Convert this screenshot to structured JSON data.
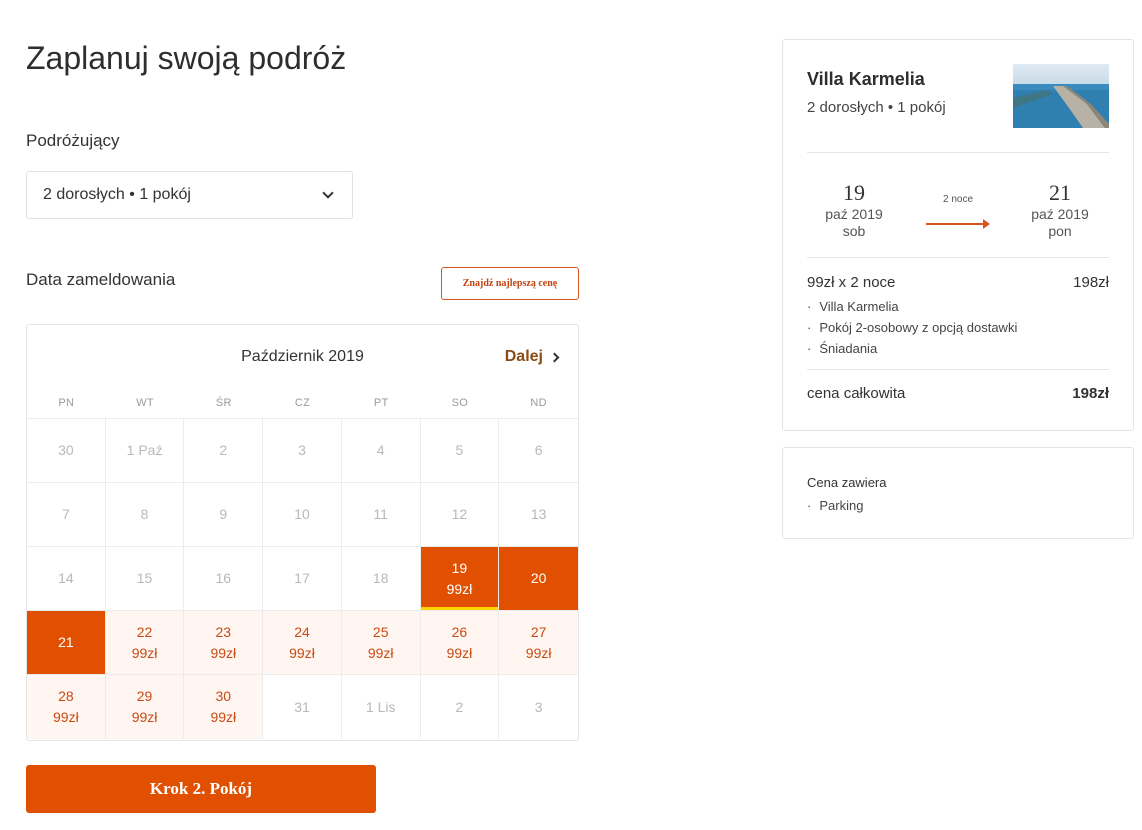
{
  "page_title": "Zaplanuj swoją podróż",
  "travelers": {
    "label": "Podróżujący",
    "value": "2 dorosłych • 1 pokój"
  },
  "checkin": {
    "label": "Data zameldowania",
    "best_price_button": "Znajdź najlepszą cenę"
  },
  "calendar": {
    "month": "Październik 2019",
    "next_label": "Dalej",
    "weekdays": [
      "PN",
      "WT",
      "ŚR",
      "CZ",
      "PT",
      "SO",
      "ND"
    ],
    "days": [
      {
        "day": "30",
        "price": "",
        "state": "past"
      },
      {
        "day": "1 Paź",
        "price": "",
        "state": "past"
      },
      {
        "day": "2",
        "price": "",
        "state": "past"
      },
      {
        "day": "3",
        "price": "",
        "state": "past"
      },
      {
        "day": "4",
        "price": "",
        "state": "past"
      },
      {
        "day": "5",
        "price": "",
        "state": "past"
      },
      {
        "day": "6",
        "price": "",
        "state": "past"
      },
      {
        "day": "7",
        "price": "",
        "state": "past"
      },
      {
        "day": "8",
        "price": "",
        "state": "past"
      },
      {
        "day": "9",
        "price": "",
        "state": "past"
      },
      {
        "day": "10",
        "price": "",
        "state": "past"
      },
      {
        "day": "11",
        "price": "",
        "state": "past"
      },
      {
        "day": "12",
        "price": "",
        "state": "past"
      },
      {
        "day": "13",
        "price": "",
        "state": "past"
      },
      {
        "day": "14",
        "price": "",
        "state": "past"
      },
      {
        "day": "15",
        "price": "",
        "state": "past"
      },
      {
        "day": "16",
        "price": "",
        "state": "past"
      },
      {
        "day": "17",
        "price": "",
        "state": "past"
      },
      {
        "day": "18",
        "price": "",
        "state": "past"
      },
      {
        "day": "19",
        "price": "99zł",
        "state": "selected-start"
      },
      {
        "day": "20",
        "price": "",
        "state": "selected"
      },
      {
        "day": "21",
        "price": "",
        "state": "selected"
      },
      {
        "day": "22",
        "price": "99zł",
        "state": "available"
      },
      {
        "day": "23",
        "price": "99zł",
        "state": "available"
      },
      {
        "day": "24",
        "price": "99zł",
        "state": "available"
      },
      {
        "day": "25",
        "price": "99zł",
        "state": "available"
      },
      {
        "day": "26",
        "price": "99zł",
        "state": "available"
      },
      {
        "day": "27",
        "price": "99zł",
        "state": "available"
      },
      {
        "day": "28",
        "price": "99zł",
        "state": "available"
      },
      {
        "day": "29",
        "price": "99zł",
        "state": "available"
      },
      {
        "day": "30",
        "price": "99zł",
        "state": "available"
      },
      {
        "day": "31",
        "price": "",
        "state": "unavailable"
      },
      {
        "day": "1 Lis",
        "price": "",
        "state": "unavailable"
      },
      {
        "day": "2",
        "price": "",
        "state": "unavailable"
      },
      {
        "day": "3",
        "price": "",
        "state": "unavailable"
      }
    ]
  },
  "step_button": "Krok 2. Pokój",
  "summary": {
    "hotel_name": "Villa Karmelia",
    "guests": "2 dorosłych • 1 pokój",
    "checkin": {
      "day": "19",
      "month": "paź 2019",
      "weekday": "sob"
    },
    "checkout": {
      "day": "21",
      "month": "paź 2019",
      "weekday": "pon"
    },
    "nights": "2 noce",
    "price_line": "99zł x 2 noce",
    "price_amount": "198zł",
    "items": [
      "Villa Karmelia",
      "Pokój 2-osobowy z opcją dostawki",
      "Śniadania"
    ],
    "total_label": "cena całkowita",
    "total_amount": "198zł"
  },
  "includes": {
    "title": "Cena zawiera",
    "items": [
      "Parking"
    ]
  },
  "colors": {
    "accent": "#e05000",
    "accent_text": "#c94a12",
    "available_bg": "#fff6f2",
    "highlight": "#ffd400"
  }
}
